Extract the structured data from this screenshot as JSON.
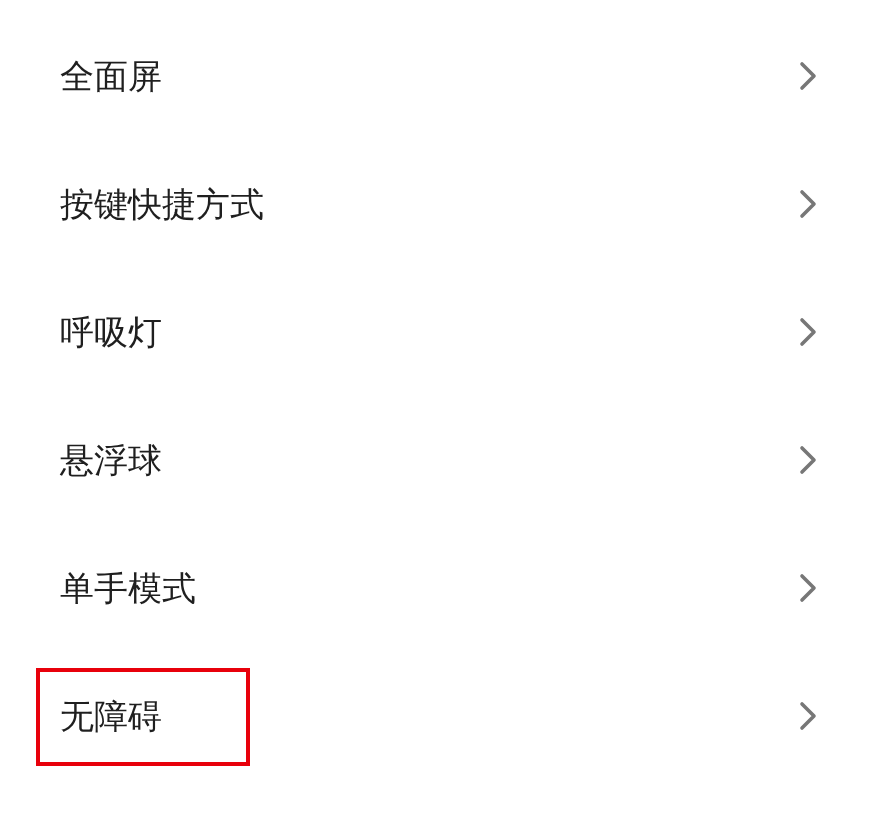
{
  "settings": [
    {
      "label": "全面屏",
      "highlighted": false
    },
    {
      "label": "按键快捷方式",
      "highlighted": false
    },
    {
      "label": "呼吸灯",
      "highlighted": false
    },
    {
      "label": "悬浮球",
      "highlighted": false
    },
    {
      "label": "单手模式",
      "highlighted": false
    },
    {
      "label": "无障碍",
      "highlighted": true
    }
  ]
}
